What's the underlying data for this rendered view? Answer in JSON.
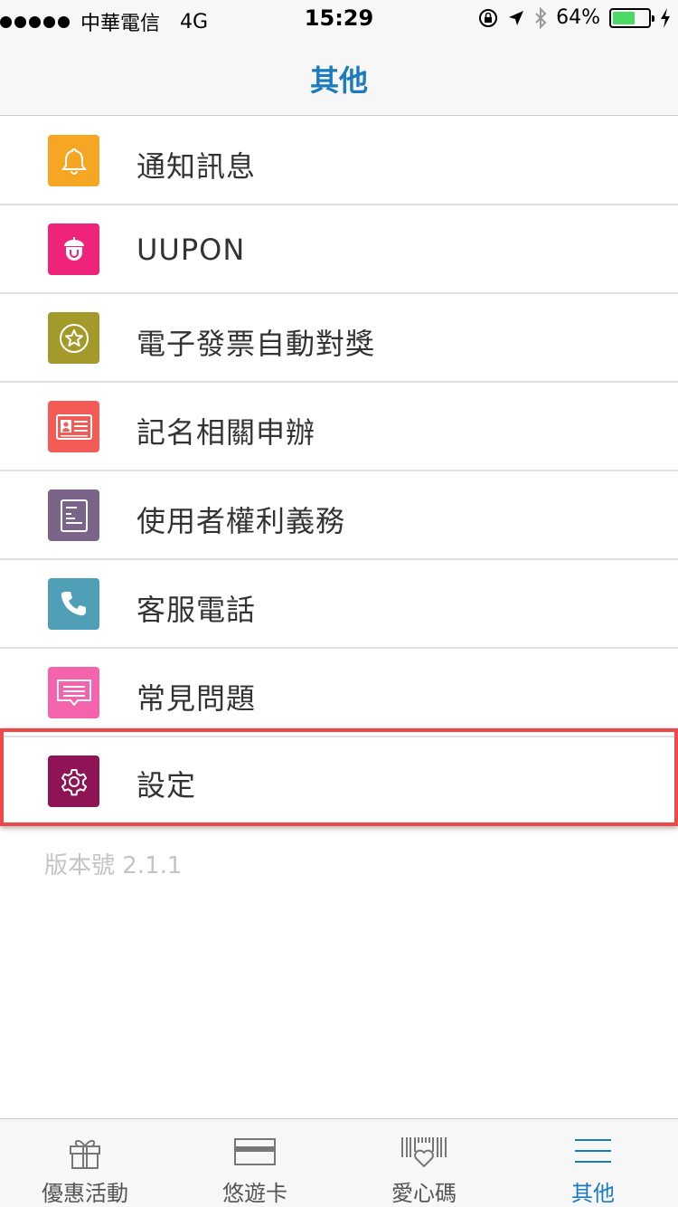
{
  "status_bar": {
    "carrier": "中華電信",
    "network": "4G",
    "time": "15:29",
    "battery": "64%",
    "battery_level": 0.64
  },
  "header": {
    "title": "其他"
  },
  "menu": {
    "items": [
      {
        "label": "通知訊息",
        "icon": "bell-icon",
        "color": "#f5a623"
      },
      {
        "label": "UUPON",
        "icon": "acorn-icon",
        "color": "#f0237b"
      },
      {
        "label": "電子發票自動對獎",
        "icon": "star-badge-icon",
        "color": "#a39a2b"
      },
      {
        "label": "記名相關申辦",
        "icon": "id-card-icon",
        "color": "#f35c56"
      },
      {
        "label": "使用者權利義務",
        "icon": "document-icon",
        "color": "#7a6588"
      },
      {
        "label": "客服電話",
        "icon": "phone-icon",
        "color": "#4f9fb7"
      },
      {
        "label": "常見問題",
        "icon": "chat-bubble-icon",
        "color": "#f464ad"
      },
      {
        "label": "設定",
        "icon": "gear-icon",
        "color": "#8f1456"
      }
    ],
    "highlight_color": "#f04848"
  },
  "version": "版本號 2.1.1",
  "tab_bar": {
    "tabs": [
      {
        "label": "優惠活動",
        "icon": "gift-icon"
      },
      {
        "label": "悠遊卡",
        "icon": "card-icon"
      },
      {
        "label": "愛心碼",
        "icon": "barcode-heart-icon"
      },
      {
        "label": "其他",
        "icon": "menu-icon",
        "active": true
      }
    ],
    "active_color": "#1a7bbf"
  }
}
